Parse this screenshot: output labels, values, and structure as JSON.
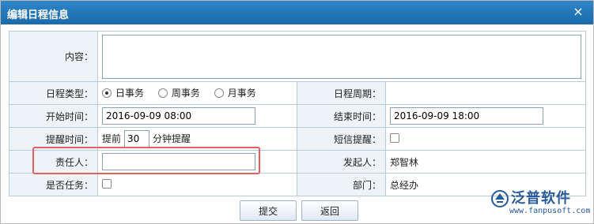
{
  "window": {
    "title": "编辑日程信息",
    "close_glyph": "×"
  },
  "form": {
    "content": {
      "label": "内容：",
      "value": ""
    },
    "schedule_type": {
      "label": "日程类型：",
      "options": [
        "日事务",
        "周事务",
        "月事务"
      ],
      "selected": "日事务"
    },
    "schedule_cycle": {
      "label": "日程周期：",
      "value": ""
    },
    "start_time": {
      "label": "开始时间：",
      "value": "2016-09-09 08:00"
    },
    "end_time": {
      "label": "结束时间：",
      "value": "2016-09-09 18:00"
    },
    "reminder": {
      "label": "提醒时间：",
      "prefix": "提前",
      "value": "30",
      "suffix": "分钟提醒"
    },
    "sms_reminder": {
      "label": "短信提醒：",
      "checked": false
    },
    "responsible": {
      "label": "责任人：",
      "value": ""
    },
    "initiator": {
      "label": "发起人：",
      "value": "郑智林"
    },
    "is_task": {
      "label": "是否任务：",
      "checked": false
    },
    "department": {
      "label": "部门：",
      "value": "总经办"
    }
  },
  "buttons": {
    "submit": "提交",
    "back": "返回"
  },
  "watermark": {
    "brand": "泛普软件",
    "url": "www.fanpusoft.com",
    "color": "#2a5a9a"
  },
  "colors": {
    "titlebar": "#1b6aa9",
    "label_bg": "#eef3f8",
    "highlight": "#e06060"
  }
}
